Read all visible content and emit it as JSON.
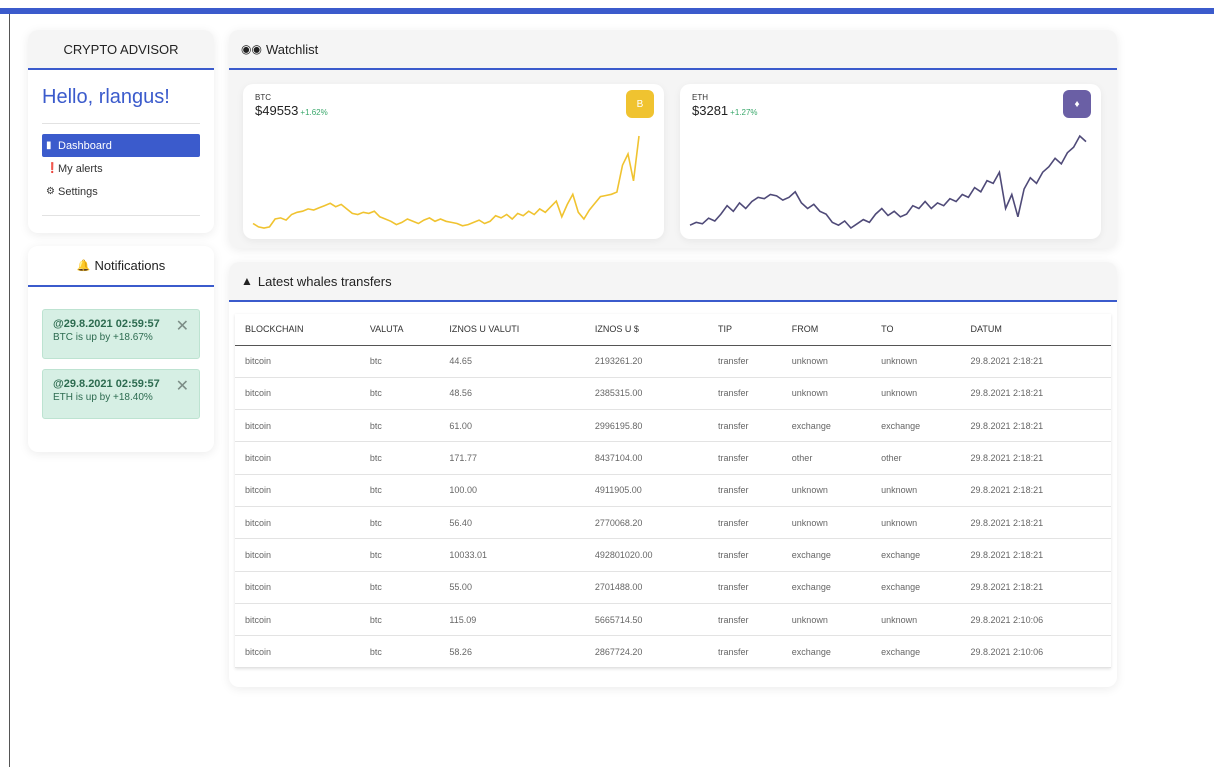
{
  "app": {
    "brand": "CRYPTO ADVISOR",
    "accent": "#3b5bcc"
  },
  "sidebar": {
    "greeting": "Hello, rlangus!",
    "items": [
      {
        "label": "Dashboard",
        "icon": "bookmark-icon",
        "active": true
      },
      {
        "label": "My alerts",
        "icon": "exclamation-circle-icon",
        "active": false
      },
      {
        "label": "Settings",
        "icon": "cogs-icon",
        "active": false
      }
    ]
  },
  "notifications": {
    "title": "Notifications",
    "items": [
      {
        "title": "@29.8.2021 02:59:57",
        "text": "BTC is up by +18.67%"
      },
      {
        "title": "@29.8.2021 02:59:57",
        "text": "ETH is up by +18.40%"
      }
    ]
  },
  "watchlist": {
    "title": "Watchlist",
    "coins": [
      {
        "symbol": "BTC",
        "price": "$49553",
        "change": "+1.62%",
        "color": "#f0c330",
        "badge": "B",
        "series": [
          20,
          17,
          16,
          17,
          24,
          25,
          23,
          28,
          30,
          31,
          33,
          32,
          34,
          36,
          38,
          35,
          37,
          33,
          29,
          28,
          30,
          29,
          31,
          26,
          24,
          22,
          19,
          21,
          24,
          22,
          20,
          23,
          25,
          22,
          24,
          22,
          21,
          20,
          18,
          19,
          21,
          23,
          20,
          22,
          27,
          25,
          28,
          24,
          29,
          27,
          31,
          28,
          33,
          30,
          35,
          40,
          26,
          37,
          46,
          30,
          24,
          32,
          38,
          44,
          45,
          46,
          48,
          72,
          82,
          58,
          98
        ]
      },
      {
        "symbol": "ETH",
        "price": "$3281",
        "change": "+1.27%",
        "color": "#4f4a78",
        "badge": "♦",
        "series": [
          28,
          30,
          29,
          33,
          31,
          36,
          42,
          38,
          44,
          40,
          45,
          48,
          47,
          50,
          49,
          46,
          48,
          52,
          44,
          40,
          43,
          38,
          36,
          30,
          28,
          31,
          26,
          29,
          32,
          30,
          36,
          40,
          35,
          38,
          34,
          36,
          42,
          40,
          45,
          40,
          44,
          42,
          47,
          45,
          50,
          48,
          55,
          52,
          60,
          58,
          66,
          40,
          50,
          34,
          54,
          62,
          58,
          66,
          70,
          76,
          72,
          80,
          84,
          92,
          88
        ]
      }
    ]
  },
  "whales": {
    "title": "Latest whales transfers",
    "columns": [
      "BLOCKCHAIN",
      "VALUTA",
      "IZNOS U VALUTI",
      "IZNOS U $",
      "TIP",
      "FROM",
      "TO",
      "DATUM"
    ],
    "rows": [
      [
        "bitcoin",
        "btc",
        "44.65",
        "2193261.20",
        "transfer",
        "unknown",
        "unknown",
        "29.8.2021 2:18:21"
      ],
      [
        "bitcoin",
        "btc",
        "48.56",
        "2385315.00",
        "transfer",
        "unknown",
        "unknown",
        "29.8.2021 2:18:21"
      ],
      [
        "bitcoin",
        "btc",
        "61.00",
        "2996195.80",
        "transfer",
        "exchange",
        "exchange",
        "29.8.2021 2:18:21"
      ],
      [
        "bitcoin",
        "btc",
        "171.77",
        "8437104.00",
        "transfer",
        "other",
        "other",
        "29.8.2021 2:18:21"
      ],
      [
        "bitcoin",
        "btc",
        "100.00",
        "4911905.00",
        "transfer",
        "unknown",
        "unknown",
        "29.8.2021 2:18:21"
      ],
      [
        "bitcoin",
        "btc",
        "56.40",
        "2770068.20",
        "transfer",
        "unknown",
        "unknown",
        "29.8.2021 2:18:21"
      ],
      [
        "bitcoin",
        "btc",
        "10033.01",
        "492801020.00",
        "transfer",
        "exchange",
        "exchange",
        "29.8.2021 2:18:21"
      ],
      [
        "bitcoin",
        "btc",
        "55.00",
        "2701488.00",
        "transfer",
        "exchange",
        "exchange",
        "29.8.2021 2:18:21"
      ],
      [
        "bitcoin",
        "btc",
        "115.09",
        "5665714.50",
        "transfer",
        "unknown",
        "unknown",
        "29.8.2021 2:10:06"
      ],
      [
        "bitcoin",
        "btc",
        "58.26",
        "2867724.20",
        "transfer",
        "exchange",
        "exchange",
        "29.8.2021 2:10:06"
      ]
    ]
  }
}
